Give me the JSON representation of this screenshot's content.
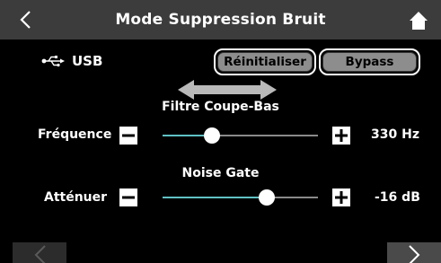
{
  "header": {
    "title": "Mode Suppression Bruit",
    "back_icon": "chevron-left-icon",
    "home_icon": "home-icon"
  },
  "source": {
    "icon": "usb-icon",
    "label": "USB"
  },
  "buttons": {
    "reset_label": "Réinitialiser",
    "bypass_label": "Bypass"
  },
  "low_cut": {
    "section_title": "Filtre Coupe-Bas",
    "row_label": "Fréquence",
    "value": "330 Hz",
    "level_fraction": 0.32
  },
  "noise_gate": {
    "section_title": "Noise Gate",
    "row_label": "Atténuer",
    "value": "-16 dB",
    "level_fraction": 0.67
  },
  "colors": {
    "background": "#000000",
    "header": "#3c3c3c",
    "accent": "#5fc1c4",
    "button_fill": "#8d8d8d"
  },
  "nav": {
    "prev_icon": "chevron-left-icon",
    "next_icon": "chevron-right-icon"
  }
}
